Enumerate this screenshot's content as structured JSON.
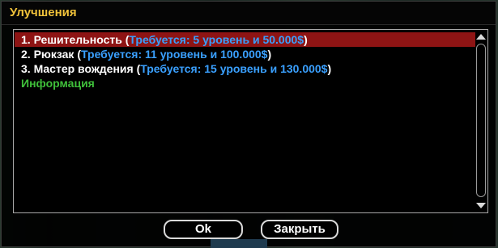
{
  "window": {
    "title": "Улучшения"
  },
  "upgrades": {
    "items": [
      {
        "prefix": "1. Решительность (",
        "requirement": "Требуется: 5 уровень и 50.000$",
        "suffix": ")"
      },
      {
        "prefix": "2. Рюкзак (",
        "requirement": "Требуется: 11 уровень и 100.000$",
        "suffix": ")"
      },
      {
        "prefix": "3. Мастер вождения (",
        "requirement": "Требуется: 15 уровень и 130.000$",
        "suffix": ")"
      }
    ],
    "info_label": "Информация"
  },
  "buttons": {
    "ok_label": "Ok",
    "close_label": "Закрыть"
  },
  "colors": {
    "title": "#f0c23a",
    "requirement": "#3aa0ff",
    "info": "#3fbf3a",
    "selection": "#8e1414"
  }
}
